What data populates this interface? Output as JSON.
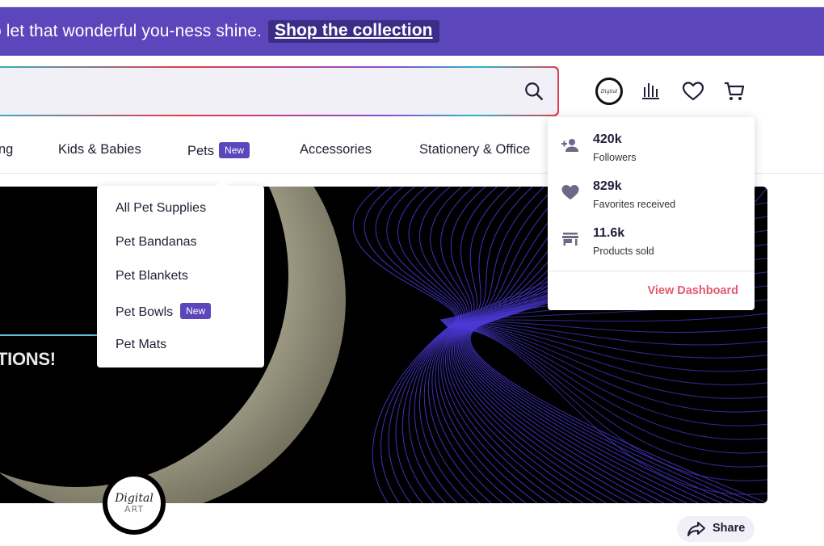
{
  "promo": {
    "text": "o let that wonderful you-ness shine.",
    "link_label": "Shop the collection"
  },
  "search": {
    "placeholder": "",
    "icon": "search-icon"
  },
  "header_icons": [
    "avatar",
    "stats-bars-icon",
    "heart-icon",
    "cart-icon"
  ],
  "nav": {
    "items": [
      {
        "label": "ng"
      },
      {
        "label": "Kids & Babies"
      },
      {
        "label": "Pets",
        "badge": "New"
      },
      {
        "label": "Accessories"
      },
      {
        "label": "Stationery & Office"
      }
    ]
  },
  "pets_menu": {
    "items": [
      {
        "label": "All Pet Supplies"
      },
      {
        "label": "Pet Bandanas"
      },
      {
        "label": "Pet Blankets"
      },
      {
        "label": "Pet Bowls",
        "badge": "New"
      },
      {
        "label": "Pet Mats"
      }
    ]
  },
  "hero": {
    "caption": "TIONS!"
  },
  "stats": {
    "rows": [
      {
        "value": "420k",
        "label": "Followers",
        "icon": "person-add-icon"
      },
      {
        "value": "829k",
        "label": "Favorites received",
        "icon": "heart-icon"
      },
      {
        "value": "11.6k",
        "label": "Products sold",
        "icon": "store-icon"
      }
    ],
    "dashboard_link": "View Dashboard"
  },
  "profile": {
    "logo_top": "Digital",
    "logo_bottom": "ART"
  },
  "share": {
    "label": "Share"
  },
  "colors": {
    "brand_purple": "#5b46bc",
    "accent_pink": "#e05a6e",
    "hero_lines": "#4b3ad8"
  }
}
